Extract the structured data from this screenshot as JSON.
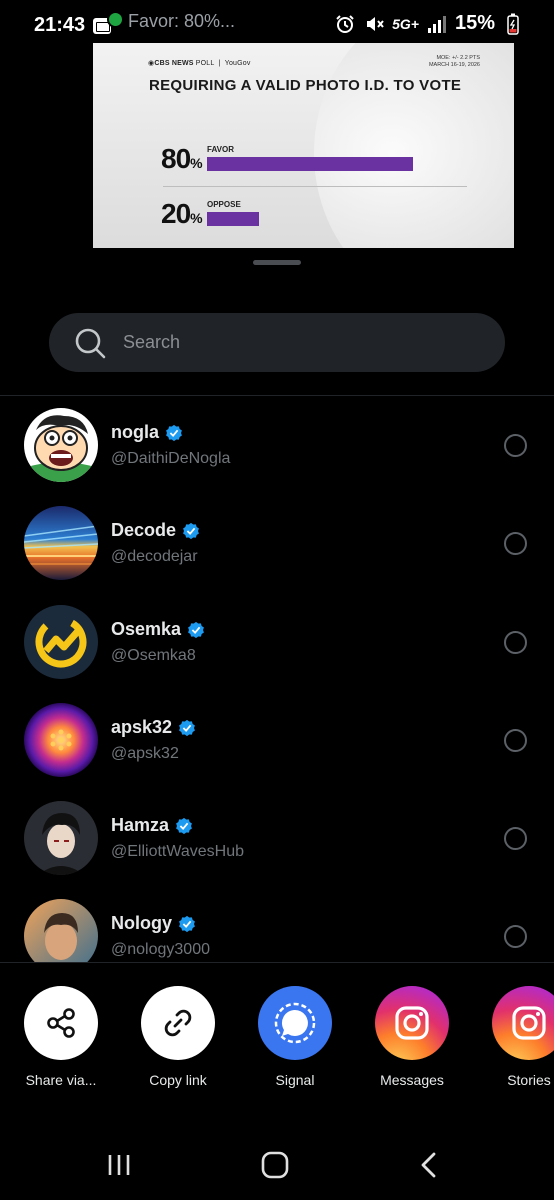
{
  "status_bar": {
    "time": "21:43",
    "notification_text": "Favor: 80%...",
    "network": "5G+",
    "battery": "15%"
  },
  "preview": {
    "source": "CBS NEWS",
    "source_suffix": "POLL",
    "partner": "YouGov",
    "moe_line1": "MOE: +/- 2.2 PTS",
    "moe_line2": "MARCH 16-19, 2026",
    "title": "REQUIRING A VALID PHOTO I.D. TO VOTE",
    "rows": [
      {
        "pct": "80",
        "sign": "%",
        "label": "FAVOR",
        "value": 80
      },
      {
        "pct": "20",
        "sign": "%",
        "label": "OPPOSE",
        "value": 20
      }
    ],
    "bar_color": "#6a31a0"
  },
  "search": {
    "placeholder": "Search"
  },
  "users": [
    {
      "name": "nogla",
      "handle": "@DaithiDeNogla",
      "avatar": "cartoon-face-avatar"
    },
    {
      "name": "Decode",
      "handle": "@decodejar",
      "avatar": "city-lights-avatar"
    },
    {
      "name": "Osemka",
      "handle": "@Osemka8",
      "avatar": "chart-logo-avatar"
    },
    {
      "name": "apsk32",
      "handle": "@apsk32",
      "avatar": "purple-sphere-avatar"
    },
    {
      "name": "Hamza",
      "handle": "@ElliottWavesHub",
      "avatar": "anime-character-avatar"
    },
    {
      "name": "Nology",
      "handle": "@nology3000",
      "avatar": "person-photo-avatar"
    }
  ],
  "share_targets": [
    {
      "label": "Share via...",
      "icon": "share-icon"
    },
    {
      "label": "Copy link",
      "icon": "link-icon"
    },
    {
      "label": "Signal",
      "icon": "signal-icon"
    },
    {
      "label": "Messages",
      "icon": "instagram-icon"
    },
    {
      "label": "Stories",
      "icon": "instagram-icon"
    }
  ],
  "colors": {
    "verified": "#1d9bf0",
    "signal": "#3a76f0",
    "background": "#000000"
  }
}
